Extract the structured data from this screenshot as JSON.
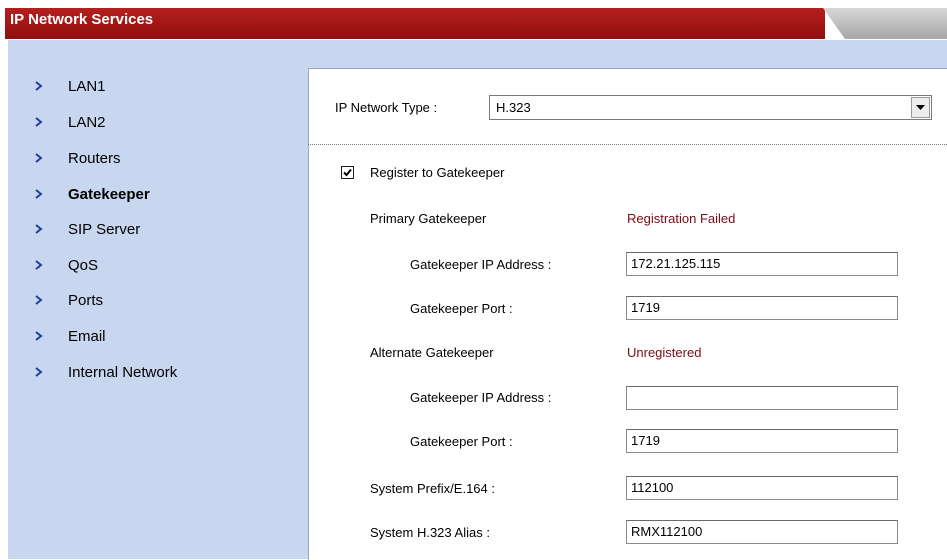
{
  "header": {
    "title": "IP Network Services"
  },
  "sidebar": {
    "items": [
      {
        "label": "LAN1"
      },
      {
        "label": "LAN2"
      },
      {
        "label": "Routers"
      },
      {
        "label": "Gatekeeper"
      },
      {
        "label": "SIP Server"
      },
      {
        "label": "QoS"
      },
      {
        "label": "Ports"
      },
      {
        "label": "Email"
      },
      {
        "label": "Internal Network"
      }
    ],
    "active_index": 3
  },
  "network_type": {
    "label": "IP Network Type :",
    "value": "H.323"
  },
  "register": {
    "label": "Register to Gatekeeper",
    "checked": true
  },
  "primary": {
    "label": "Primary Gatekeeper",
    "status": "Registration Failed",
    "ip_label": "Gatekeeper IP Address :",
    "ip_value": "172.21.125.115",
    "port_label": "Gatekeeper Port :",
    "port_value": "1719"
  },
  "alternate": {
    "label": "Alternate Gatekeeper",
    "status": "Unregistered",
    "ip_label": "Gatekeeper IP Address :",
    "ip_value": "",
    "port_label": "Gatekeeper Port :",
    "port_value": "1719"
  },
  "prefix": {
    "label": "System Prefix/E.164 :",
    "value": "112100"
  },
  "alias": {
    "label": "System H.323 Alias :",
    "value": "RMX112100"
  },
  "colors": {
    "header_red": "#a4181a",
    "nav_bg": "#c9d6ef",
    "status_red": "#7a0a16",
    "chevron": "#1f3f9a"
  }
}
